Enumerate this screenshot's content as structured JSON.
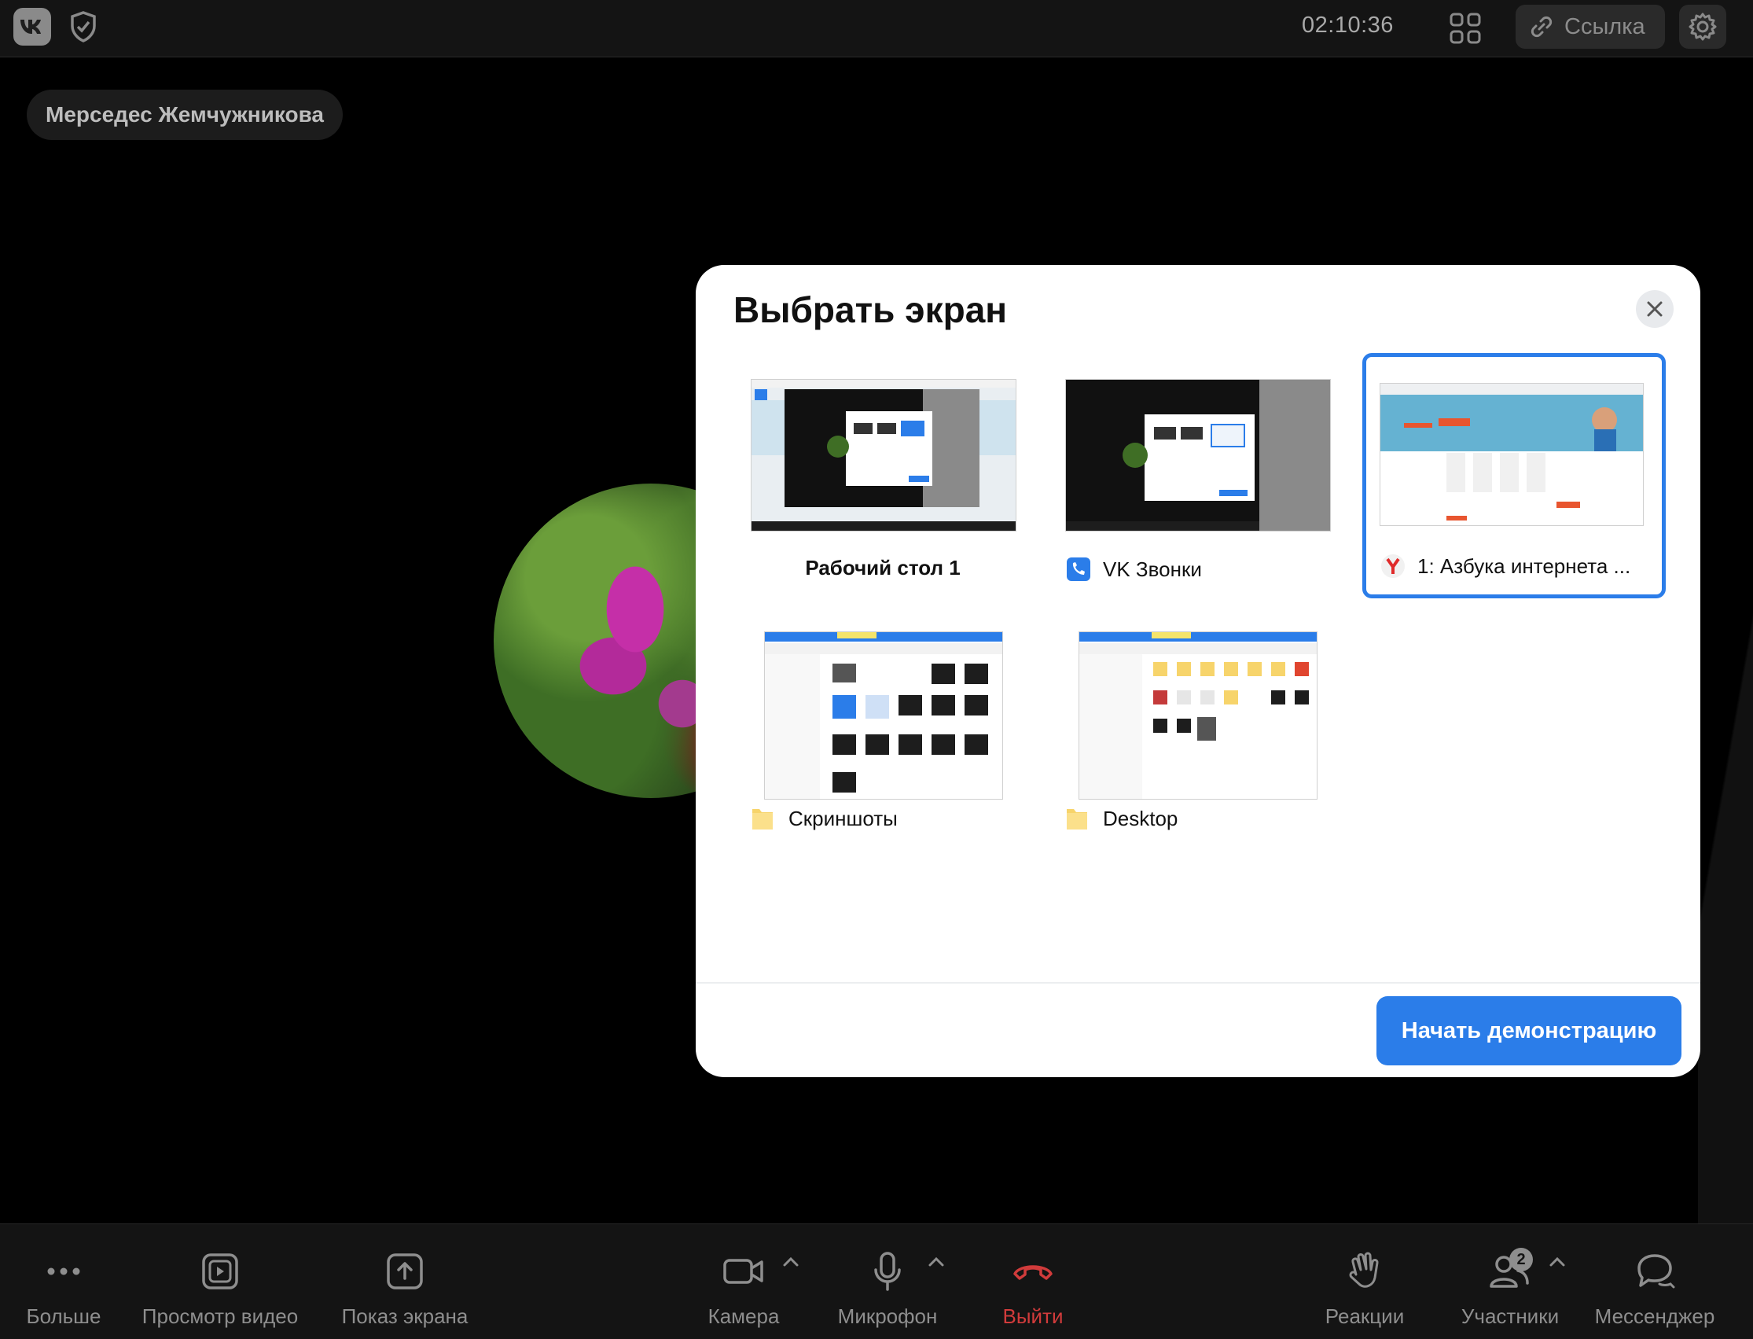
{
  "topbar": {
    "timer": "02:10:36",
    "link_label": "Ссылка"
  },
  "participant": {
    "name": "Мерседес Жемчужникова"
  },
  "dialog": {
    "title": "Выбрать экран",
    "sources": [
      {
        "label": "Рабочий стол 1",
        "icon": "none",
        "selected": false
      },
      {
        "label": "VK Звонки",
        "icon": "vk-calls-icon",
        "selected": false
      },
      {
        "label": "1: Азбука интернета ...",
        "icon": "yandex-browser-icon",
        "selected": true
      },
      {
        "label": "Скриншоты",
        "icon": "folder-icon",
        "selected": false
      },
      {
        "label": "Desktop",
        "icon": "folder-icon",
        "selected": false
      }
    ],
    "start_button": "Начать демонстрацию"
  },
  "toolbar": {
    "more": "Больше",
    "video_preview": "Просмотр видео",
    "screen_share": "Показ экрана",
    "camera": "Камера",
    "microphone": "Микрофон",
    "leave": "Выйти",
    "reactions": "Реакции",
    "participants": "Участники",
    "participants_count": "2",
    "messenger": "Мессенджер"
  },
  "colors": {
    "accent": "#2b7de9",
    "leave": "#d13b3b",
    "background": "#000000"
  }
}
